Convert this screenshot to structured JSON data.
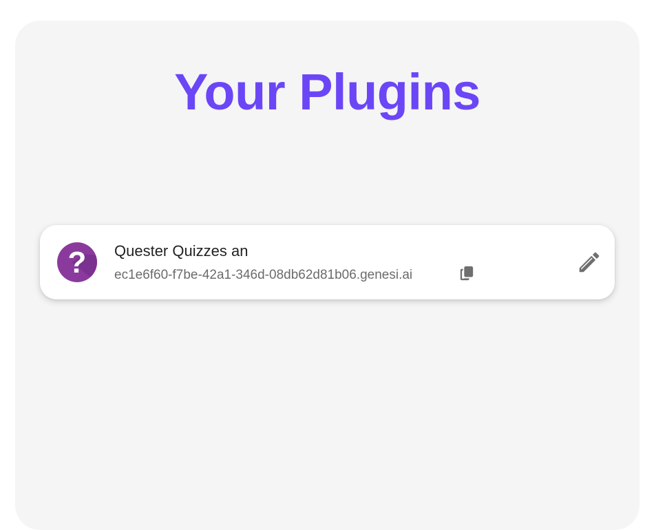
{
  "page": {
    "title": "Your Plugins"
  },
  "plugins": [
    {
      "name": "Quester Quizzes an",
      "domain": "ec1e6f60-f7be-42a1-346d-08db62d81b06.genesi.ai",
      "avatar_icon": "question-mark-icon",
      "copy_icon": "copy-icon",
      "edit_icon": "pencil-icon"
    }
  ],
  "colors": {
    "title": "#6b46f6",
    "panel_background": "#f5f5f5",
    "avatar_purple": "#8a3a9c",
    "muted_text": "#6b6b6b",
    "icon_gray": "#6f6f6f"
  }
}
